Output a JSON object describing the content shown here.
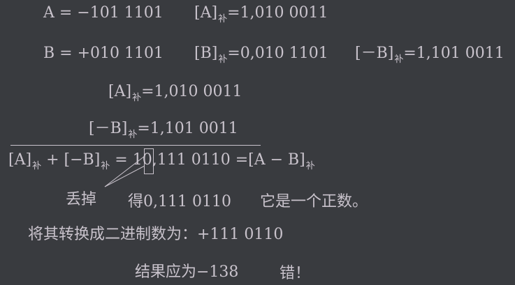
{
  "lines": {
    "a_eq": "A = −101 1101",
    "a_comp_pre": "[A]",
    "sub_bu": "补",
    "a_comp_val": "=1,010 0011",
    "b_eq": "B = +010 1101",
    "b_comp_pre": "[B]",
    "b_comp_val": "=0,010 1101",
    "neg_b_comp_pre": "[－B]",
    "neg_b_comp_val": "=1,101 0011",
    "add1_pre": "[A]",
    "add1_val": "=1,010 0011",
    "add2_pre": "[－B]",
    "add2_val": "=1,101 0011",
    "sum_part1": "[A]",
    "sum_plus": "+ [−B]",
    "sum_eq": "=",
    "sum_carry": "1",
    "sum_rest": "0,111 0110 =[A − B]",
    "discard": "丢掉",
    "result_value": "得0,111 0110",
    "result_positive": "它是一个正数。",
    "convert": "将其转换成二进制数为：+111 0110",
    "expected": "结果应为−138",
    "wrong": "错！"
  }
}
